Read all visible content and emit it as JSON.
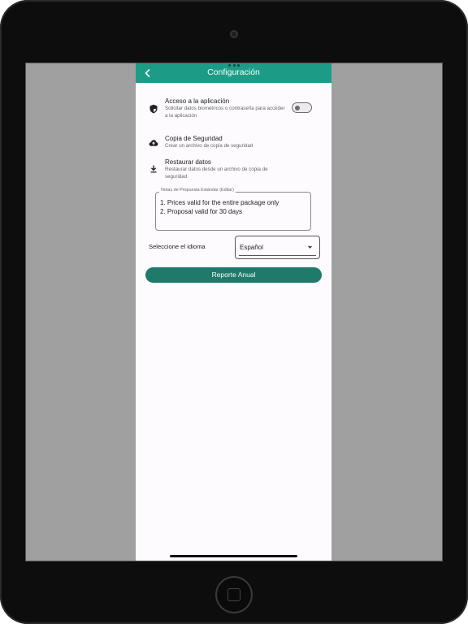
{
  "header": {
    "title": "Configuración"
  },
  "settings": {
    "app_access": {
      "title": "Acceso a la aplicación",
      "subtitle": "Solicitar datos biométricos o contraseña para acceder a la aplicación",
      "toggle_on": false
    },
    "backup": {
      "title": "Copia de Seguridad",
      "subtitle": "Crear un archivo de copia de seguridad"
    },
    "restore": {
      "title": "Restaurar datos",
      "subtitle": "Restaurar datos desde un archivo de copia de seguridad"
    }
  },
  "notes": {
    "label": "Notas de Propuesta Estándar (Editar)",
    "value": "1. Prices valid for the entire package only\n2. Proposal valid for 30 days"
  },
  "language": {
    "label": "Seleccione el idioma",
    "selected": "Español"
  },
  "report_button": {
    "label": "Reporte Anual"
  },
  "icons": {
    "back": "chevron-left-icon",
    "shield": "shield-icon",
    "cloud_upload": "cloud-upload-icon",
    "download": "download-icon",
    "caret": "caret-down-icon"
  },
  "colors": {
    "header": "#1c9c86",
    "button": "#1f7a6c"
  }
}
